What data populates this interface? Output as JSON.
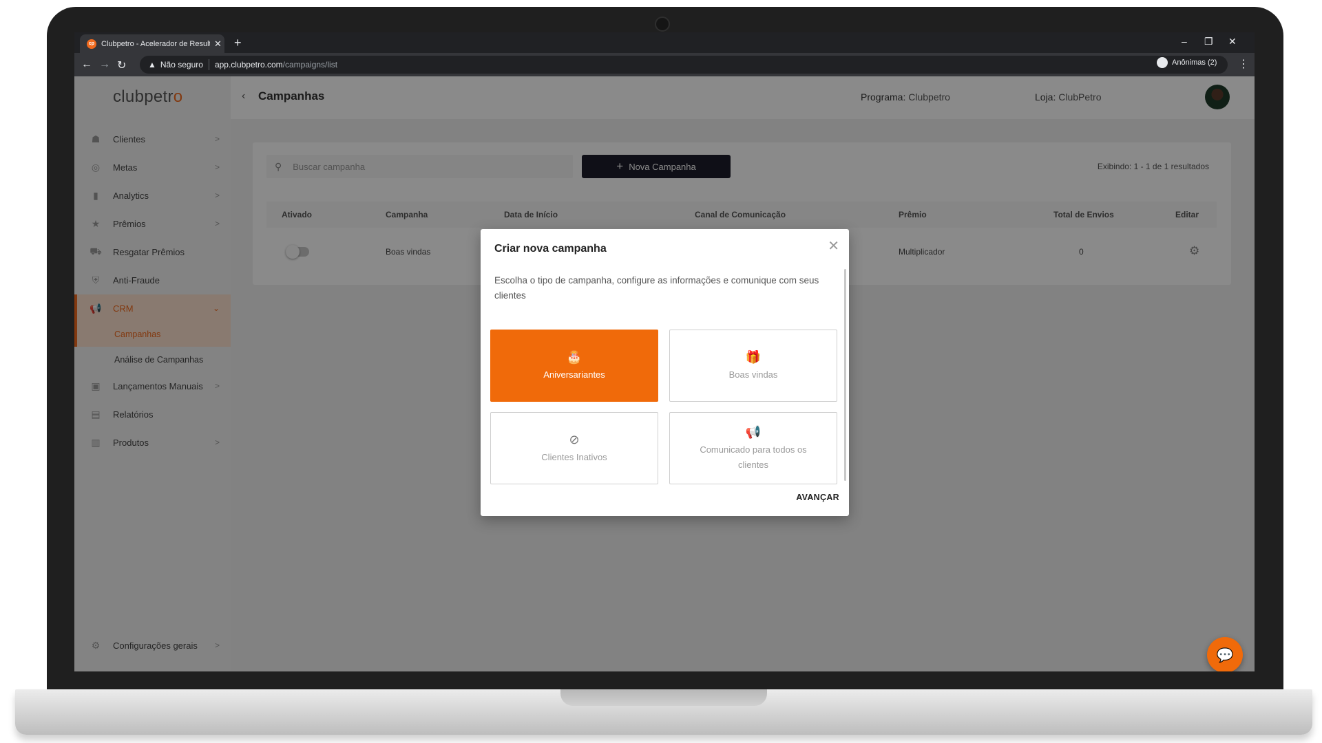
{
  "browser": {
    "tab_title": "Clubpetro - Acelerador de Resultados",
    "tab_favicon_text": "cp",
    "not_secure_label": "Não seguro",
    "url_host": "app.clubpetro.com",
    "url_path": "/campaigns/list",
    "incognito_label": "Anônimas (2)"
  },
  "logo": {
    "main": "clubpetr",
    "accent": "o"
  },
  "header": {
    "title": "Campanhas",
    "program_label": "Programa:",
    "program_value": "Clubpetro",
    "store_label": "Loja:",
    "store_value": "ClubPetro"
  },
  "sidebar": {
    "items": [
      {
        "label": "Clientes",
        "icon": "person-icon"
      },
      {
        "label": "Metas",
        "icon": "target-icon"
      },
      {
        "label": "Analytics",
        "icon": "bar-chart-icon"
      },
      {
        "label": "Prêmios",
        "icon": "star-icon"
      },
      {
        "label": "Resgatar Prêmios",
        "icon": "cart-icon"
      },
      {
        "label": "Anti-Fraude",
        "icon": "shield-icon"
      },
      {
        "label": "CRM",
        "icon": "megaphone-icon"
      },
      {
        "label": "Lançamentos Manuais",
        "icon": "search-doc-icon"
      },
      {
        "label": "Relatórios",
        "icon": "clipboard-icon"
      },
      {
        "label": "Produtos",
        "icon": "products-icon"
      }
    ],
    "crm_sub": [
      "Campanhas",
      "Análise de Campanhas"
    ],
    "footer": "Configurações gerais"
  },
  "list": {
    "search_placeholder": "Buscar campanha",
    "new_button": "Nova Campanha",
    "results": "Exibindo: 1 - 1 de 1 resultados",
    "columns": [
      "Ativado",
      "Campanha",
      "Data de Início",
      "Canal de Comunicação",
      "Prêmio",
      "Total de Envios",
      "Editar"
    ],
    "rows": [
      {
        "campanha": "Boas vindas",
        "premio": "Multiplicador",
        "envios": "0"
      }
    ]
  },
  "modal": {
    "title": "Criar nova campanha",
    "description": "Escolha o tipo de campanha, configure as informações e comunique com seus clientes",
    "options": [
      {
        "label": "Aniversariantes",
        "icon": "cake-icon",
        "selected": true
      },
      {
        "label": "Boas vindas",
        "icon": "gift-icon",
        "selected": false
      },
      {
        "label": "Clientes Inativos",
        "icon": "inactive-user-icon",
        "selected": false
      },
      {
        "label": "Comunicado para todos os clientes",
        "icon": "megaphone-icon",
        "selected": false
      }
    ],
    "advance_label": "AVANÇAR"
  },
  "colors": {
    "brand": "#f06a0a",
    "dark_button": "#1c1c2b"
  }
}
